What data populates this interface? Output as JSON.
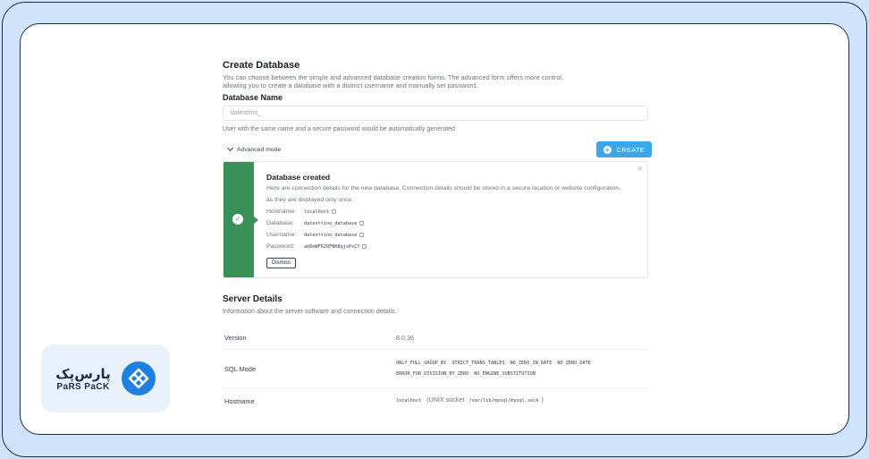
{
  "create": {
    "title": "Create Database",
    "description_line1": "You can choose between the simple and advanced database creation forms. The advanced form offers more control,",
    "description_line2": "allowing you to create a database with a distinct username and manually set password.",
    "name_label": "Database Name",
    "name_value": "datesttino_",
    "hint": "User with the same name and a secure password would be automatically generated",
    "advanced_mode_label": "Advanced mode",
    "create_button_label": "CREATE"
  },
  "alert": {
    "title": "Database created",
    "text": "Here are connection details for the new database. Connection details should be stored in a secure location or website configuration, as they are displayed only once.",
    "fields": [
      {
        "label": "Hostname:",
        "value": "localhost"
      },
      {
        "label": "Database:",
        "value": "datesttino_database"
      },
      {
        "label": "Username:",
        "value": "datesttino_database"
      },
      {
        "label": "Password:",
        "value": "abDmWFR2QFNK8qjsPsCY"
      }
    ],
    "dismiss_label": "Dismiss",
    "close_glyph": "×"
  },
  "server": {
    "title": "Server Details",
    "description": "Information about the server software and connection details.",
    "version_label": "Version",
    "version_value": "8.0.36",
    "sqlmode_label": "SQL Mode",
    "sqlmode_values": [
      "ONLY_FULL_GROUP_BY",
      "STRICT_TRANS_TABLES",
      "NO_ZERO_IN_DATE",
      "NO_ZERO_DATE",
      "ERROR_FOR_DIVISION_BY_ZERO",
      "NO_ENGINE_SUBSTITUTION"
    ],
    "hostname_label": "Hostname",
    "hostname_value": "localhost",
    "hostname_socket_prefix": "(UNIX socket",
    "hostname_socket_path": "/var/lib/mysql/mysql.sock",
    "hostname_socket_suffix": ")"
  },
  "logo": {
    "fa_text": "پارس‌پک",
    "en_text": "PaRS PaCK"
  },
  "colors": {
    "accent": "#3ca6e8",
    "success": "#3a9158",
    "frame": "#1e2a4a",
    "background": "#cfe3fb"
  }
}
